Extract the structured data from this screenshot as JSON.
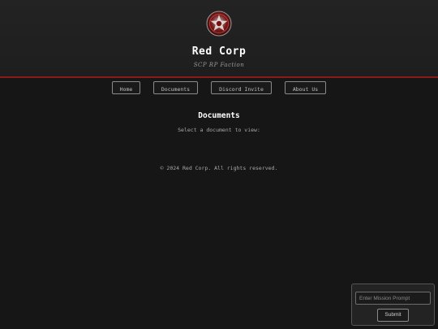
{
  "header": {
    "title": "Red Corp",
    "subtitle": "SCP RP Faction",
    "logo_icon": "red-corp-emblem-icon"
  },
  "nav": {
    "items": [
      {
        "label": "Home"
      },
      {
        "label": "Documents"
      },
      {
        "label": "Discord Invite"
      },
      {
        "label": "About Us"
      }
    ]
  },
  "main": {
    "section_title": "Documents",
    "section_text": "Select a document to view:"
  },
  "footer": {
    "text": "© 2024 Red Corp. All rights reserved."
  },
  "prompt_panel": {
    "input_placeholder": "Enter Mission Prompt",
    "input_value": "",
    "submit_label": "Submit"
  },
  "colors": {
    "background": "#161616",
    "header_background": "#222222",
    "accent_red": "#8b1a1a",
    "text": "#ffffff"
  }
}
